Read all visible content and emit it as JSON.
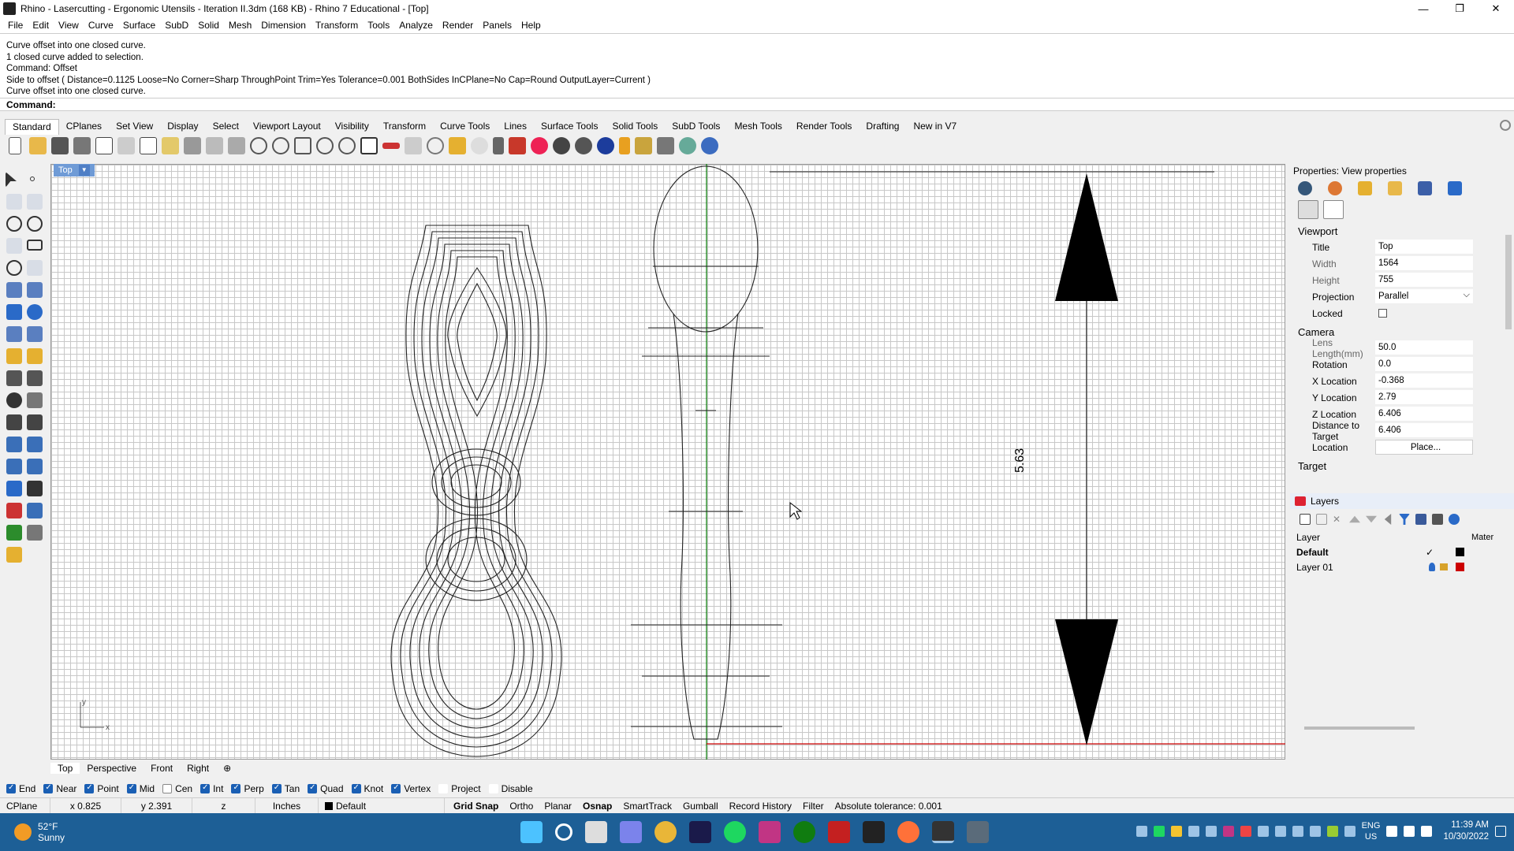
{
  "window": {
    "title": "Rhino - Lasercutting - Ergonomic Utensils - Iteration II.3dm (168 KB) - Rhino 7 Educational - [Top]",
    "minimize": "—",
    "maximize": "❐",
    "close": "✕"
  },
  "menu": [
    "File",
    "Edit",
    "View",
    "Curve",
    "Surface",
    "SubD",
    "Solid",
    "Mesh",
    "Dimension",
    "Transform",
    "Tools",
    "Analyze",
    "Render",
    "Panels",
    "Help"
  ],
  "command_history": [
    "Curve offset into one closed curve.",
    "1 closed curve added to selection.",
    "Command: Offset",
    "Side to offset ( Distance=0.1125  Loose=No  Corner=Sharp  ThroughPoint  Trim=Yes  Tolerance=0.001  BothSides  InCPlane=No  Cap=Round  OutputLayer=Current )",
    "Curve offset into one closed curve."
  ],
  "command_prompt": "Command:",
  "toolbar_tabs": [
    "Standard",
    "CPlanes",
    "Set View",
    "Display",
    "Select",
    "Viewport Layout",
    "Visibility",
    "Transform",
    "Curve Tools",
    "Lines",
    "Surface Tools",
    "Solid Tools",
    "SubD Tools",
    "Mesh Tools",
    "Render Tools",
    "Drafting",
    "New in V7"
  ],
  "viewport": {
    "title": "Top",
    "dimension_label": "5.63",
    "axis_y": "y",
    "axis_x": "x"
  },
  "viewport_tabs": [
    "Top",
    "Perspective",
    "Front",
    "Right",
    "⊕"
  ],
  "properties": {
    "header": "Properties: View properties",
    "viewport_section": "Viewport",
    "viewport_rows": [
      {
        "k": "Title",
        "v": "Top"
      },
      {
        "k": "Width",
        "v": "1564"
      },
      {
        "k": "Height",
        "v": "755"
      },
      {
        "k": "Projection",
        "v": "Parallel"
      },
      {
        "k": "Locked",
        "v": ""
      }
    ],
    "camera_section": "Camera",
    "camera_rows": [
      {
        "k": "Lens Length(mm)",
        "v": "50.0"
      },
      {
        "k": "Rotation",
        "v": "0.0"
      },
      {
        "k": "X Location",
        "v": "-0.368"
      },
      {
        "k": "Y Location",
        "v": "2.79"
      },
      {
        "k": "Z Location",
        "v": "6.406"
      },
      {
        "k": "Distance to Target",
        "v": "6.406"
      },
      {
        "k": "Location",
        "v": "Place..."
      }
    ],
    "target_section": "Target"
  },
  "layers": {
    "header": "Layers",
    "col_layer": "Layer",
    "col_material": "Mater",
    "rows": [
      {
        "name": "Default",
        "check": "✓"
      },
      {
        "name": "Layer 01",
        "check": ""
      }
    ]
  },
  "osnaps": [
    {
      "label": "End",
      "on": true
    },
    {
      "label": "Near",
      "on": true
    },
    {
      "label": "Point",
      "on": true
    },
    {
      "label": "Mid",
      "on": true
    },
    {
      "label": "Cen",
      "on": false
    },
    {
      "label": "Int",
      "on": true
    },
    {
      "label": "Perp",
      "on": true
    },
    {
      "label": "Tan",
      "on": true
    },
    {
      "label": "Quad",
      "on": true
    },
    {
      "label": "Knot",
      "on": true
    },
    {
      "label": "Vertex",
      "on": true
    },
    {
      "label": "Project",
      "on": false
    },
    {
      "label": "Disable",
      "on": false
    }
  ],
  "status": {
    "cplane": "CPlane",
    "x": "x 0.825",
    "y": "y 2.391",
    "z": "z",
    "units": "Inches",
    "layer": "Default",
    "buttons": [
      "Grid Snap",
      "Ortho",
      "Planar",
      "Osnap",
      "SmartTrack",
      "Gumball",
      "Record History",
      "Filter"
    ],
    "tolerance": "Absolute tolerance: 0.001"
  },
  "taskbar": {
    "temp": "52°F",
    "weather": "Sunny",
    "lang1": "ENG",
    "lang2": "US",
    "time": "11:39 AM",
    "date": "10/30/2022"
  },
  "colors": {
    "accent": "#1a5fb4",
    "taskbar": "#1d5f96",
    "viewport_title": "#6f9bd6",
    "layer_default_color": "#000000",
    "layer_01_color": "#cc0000",
    "x_axis": "#cc0000",
    "y_axis": "#007a00"
  }
}
